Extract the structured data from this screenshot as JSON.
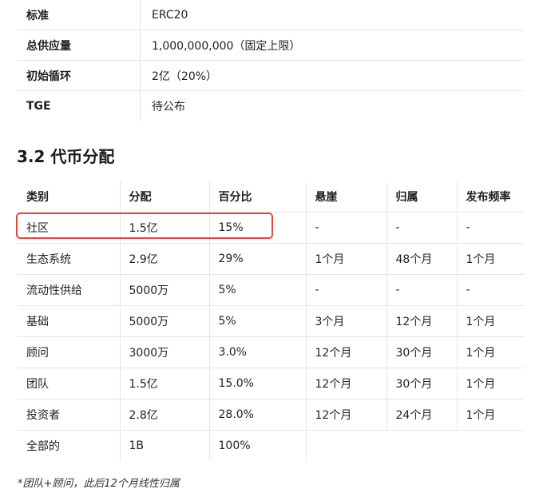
{
  "token_info": [
    {
      "label": "标准",
      "value": "ERC20"
    },
    {
      "label": "总供应量",
      "value": "1,000,000,000（固定上限）"
    },
    {
      "label": "初始循环",
      "value": "2亿（20%）"
    },
    {
      "label": "TGE",
      "value": "待公布"
    }
  ],
  "section": {
    "title": "3.2 代币分配"
  },
  "distribution": {
    "headers": [
      "类别",
      "分配",
      "百分比",
      "悬崖",
      "归属",
      "发布频率"
    ],
    "rows": [
      [
        "社区",
        "1.5亿",
        "15%",
        "-",
        "-",
        "-"
      ],
      [
        "生态系统",
        "2.9亿",
        "29%",
        "1个月",
        "48个月",
        "1个月"
      ],
      [
        "流动性供给",
        "5000万",
        "5%",
        "-",
        "-",
        "-"
      ],
      [
        "基础",
        "5000万",
        "5%",
        "3个月",
        "12个月",
        "1个月"
      ],
      [
        "顾问",
        "3000万",
        "3.0%",
        "12个月",
        "30个月",
        "1个月"
      ],
      [
        "团队",
        "1.5亿",
        "15.0%",
        "12个月",
        "30个月",
        "1个月"
      ],
      [
        "投资者",
        "2.8亿",
        "28.0%",
        "12个月",
        "24个月",
        "1个月"
      ],
      [
        "全部的",
        "1B",
        "100%",
        "",
        "",
        ""
      ]
    ],
    "highlight_color": "#e0483c"
  },
  "footnote": "*团队+顾问，此后12个月线性归属"
}
